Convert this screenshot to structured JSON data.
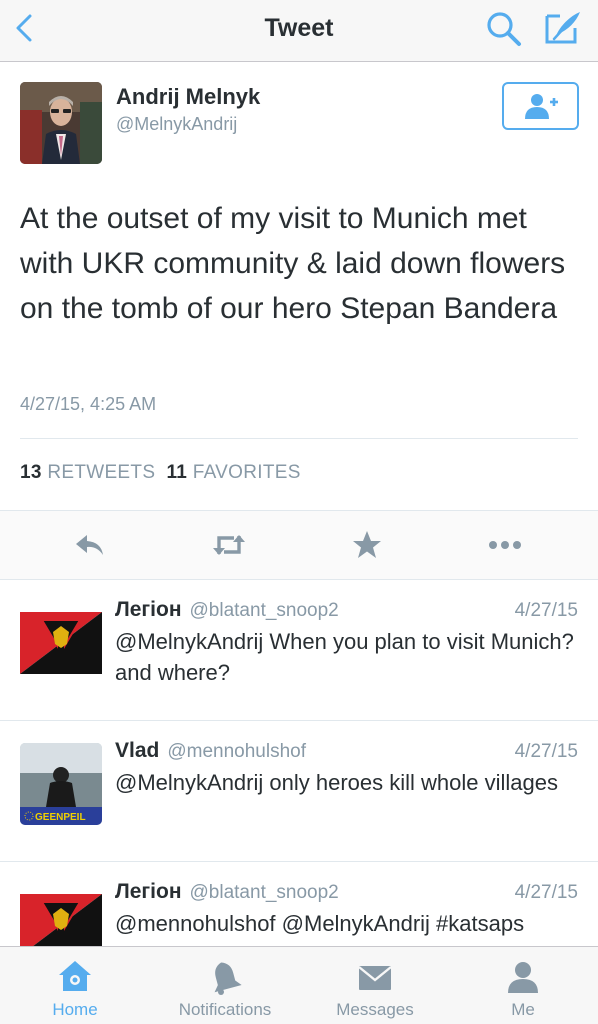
{
  "navbar": {
    "title": "Tweet",
    "back_icon": "chevron-left-icon",
    "search_icon": "search-icon",
    "compose_icon": "compose-icon"
  },
  "tweet": {
    "author_name": "Andrij Melnyk",
    "author_handle": "@MelnykAndrij",
    "text": "At the outset of my visit to Munich met with UKR community & laid down flowers on the tomb of our hero Stepan Bandera",
    "timestamp": "4/27/15, 4:25 AM",
    "retweets_count": "13",
    "retweets_label": "RETWEETS",
    "favorites_count": "11",
    "favorites_label": "FAVORITES",
    "follow_icon": "add-user-icon",
    "actions": [
      "reply-icon",
      "retweet-icon",
      "favorite-icon",
      "more-icon"
    ]
  },
  "replies": [
    {
      "name": "Легіон",
      "handle": "@blatant_snoop2",
      "date": "4/27/15",
      "text": "@MelnykAndrij When you plan to visit Munich? and where?"
    },
    {
      "name": "Vlad",
      "handle": "@mennohulshof",
      "date": "4/27/15",
      "text": "@MelnykAndrij only heroes kill whole villages",
      "avatar_badge": "GEENPEIL"
    },
    {
      "name": "Легіон",
      "handle": "@blatant_snoop2",
      "date": "4/27/15",
      "text": "@mennohulshof @MelnykAndrij #katsaps"
    }
  ],
  "tabbar": {
    "tabs": [
      {
        "label": "Home",
        "icon": "home-icon",
        "active": true
      },
      {
        "label": "Notifications",
        "icon": "bell-icon",
        "active": false
      },
      {
        "label": "Messages",
        "icon": "envelope-icon",
        "active": false
      },
      {
        "label": "Me",
        "icon": "person-icon",
        "active": false
      }
    ]
  },
  "colors": {
    "accent": "#55acee",
    "text": "#292f33",
    "muted": "#8899a6",
    "flag_red": "#d8232a",
    "flag_black": "#111111"
  }
}
